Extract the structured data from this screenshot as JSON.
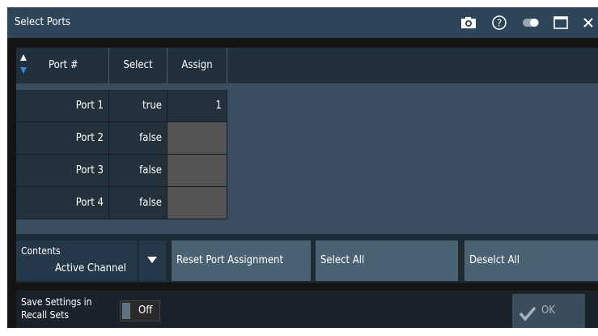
{
  "dialog": {
    "title": "Select Ports",
    "title_icons": [
      "camera-icon",
      "help-icon",
      "toggle-icon",
      "maximize-icon",
      "close-icon"
    ]
  },
  "table": {
    "headers": {
      "port": "Port #",
      "select": "Select",
      "assign": "Assign"
    },
    "rows": [
      {
        "port": "Port 1",
        "select": "true",
        "assign": "1"
      },
      {
        "port": "Port 2",
        "select": "false",
        "assign": ""
      },
      {
        "port": "Port 3",
        "select": "false",
        "assign": ""
      },
      {
        "port": "Port 4",
        "select": "false",
        "assign": ""
      }
    ]
  },
  "controls": {
    "contents_label": "Contents",
    "contents_value": "Active Channel",
    "reset_label": "Reset Port Assignment",
    "select_all_label": "Select All",
    "deselect_all_label": "Deselct All"
  },
  "footer": {
    "save_line1": "Save Settings in",
    "save_line2": "Recall Sets",
    "toggle_value": "Off",
    "ok_label": "OK"
  },
  "colors": {
    "titlebar": "#2e4458",
    "button": "#4b6273",
    "sort_down_arrow": "#2f8be0"
  }
}
